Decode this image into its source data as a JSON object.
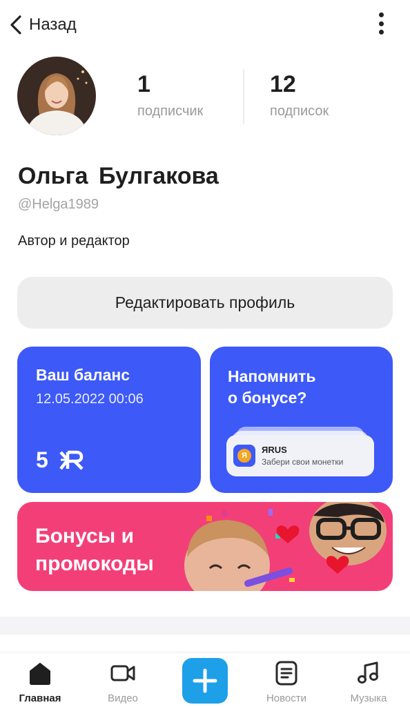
{
  "header": {
    "back_label": "Назад"
  },
  "profile": {
    "name": "Ольга  Булгакова",
    "handle": "@Helga1989",
    "bio": "Автор и редактор",
    "followers_count": "1",
    "followers_label": "подписчик",
    "following_count": "12",
    "following_label": "подписок",
    "edit_button_label": "Редактировать профиль"
  },
  "balance_card": {
    "title": "Ваш баланс",
    "date": "12.05.2022 00:06",
    "amount": "5",
    "currency_icon": "yarus-coin-icon",
    "color": "#3d59f7"
  },
  "remind_card": {
    "title_line1": "Напомнить",
    "title_line2": "о бонусе?",
    "notification": {
      "app_name": "ЯRUS",
      "text": "Забери свои монетки"
    }
  },
  "promo_banner": {
    "title_line1": "Бонусы и",
    "title_line2": "промокоды",
    "color": "#f33f78"
  },
  "tabbar": {
    "tabs": [
      {
        "label": "Главная",
        "icon": "home-icon",
        "active": true
      },
      {
        "label": "Видео",
        "icon": "video-camera-icon",
        "active": false
      },
      {
        "label": "",
        "icon": "plus-icon",
        "active": false
      },
      {
        "label": "Новости",
        "icon": "news-icon",
        "active": false
      },
      {
        "label": "Музыка",
        "icon": "music-note-icon",
        "active": false
      }
    ],
    "plus_color": "#1ea0e8"
  }
}
